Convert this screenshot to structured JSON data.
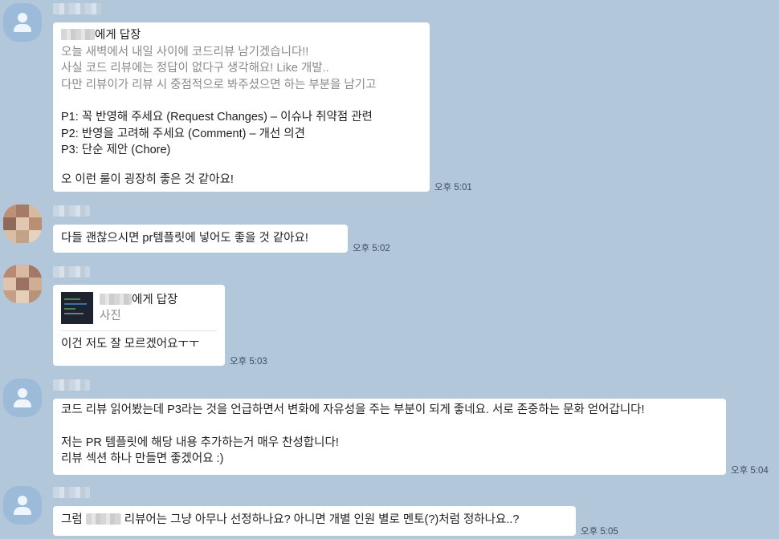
{
  "messages": [
    {
      "reply_suffix": "에게 답장",
      "quote_lines": [
        "오늘 새벽에서 내일 사이에 코드리뷰 남기겠습니다!!",
        "사실 코드 리뷰에는 정답이 없다구 생각해요! Like 개발..",
        "다만 리뷰이가 리뷰 시 중점적으로 봐주셨으면 하는 부분을 남기고"
      ],
      "lines": [
        "P1: 꼭 반영해 주세요 (Request Changes) – 이슈나 취약점 관련",
        "P2: 반영을 고려해 주세요 (Comment) – 개선 의견",
        "P3: 단순 제안 (Chore)"
      ],
      "closing": "오 이런 룰이 굉장히 좋은 것 같아요!",
      "time": "오후 5:01"
    },
    {
      "text": "다들 괜찮으시면 pr템플릿에 넣어도 좋을 것 같아요!",
      "time": "오후 5:02"
    },
    {
      "reply_suffix": "에게 답장",
      "photo_label": "사진",
      "text": "이건 저도 잘 모르겠어요ㅜㅜ",
      "time": "오후 5:03"
    },
    {
      "line1": "코드 리뷰 읽어봤는데 P3라는 것을 언급하면서 변화에 자유성을 주는 부분이 되게 좋네요. 서로 존중하는 문화 얻어갑니다!",
      "line2": "저는 PR 템플릿에 해당 내용 추가하는거 매우 찬성합니다!",
      "line3": "리뷰 섹션 하나 만들면 좋겠어요 :)",
      "time": "오후 5:04"
    },
    {
      "prefix": "그럼",
      "suffix": "리뷰어는 그냥 아무나 선정하나요? 아니면 개별 인원 별로 멘토(?)처럼 정하나요..?",
      "time": "오후 5:05"
    }
  ],
  "colors": {
    "background": "#b2c7da",
    "bubble": "#ffffff",
    "default_avatar": "#9bbbd8"
  }
}
